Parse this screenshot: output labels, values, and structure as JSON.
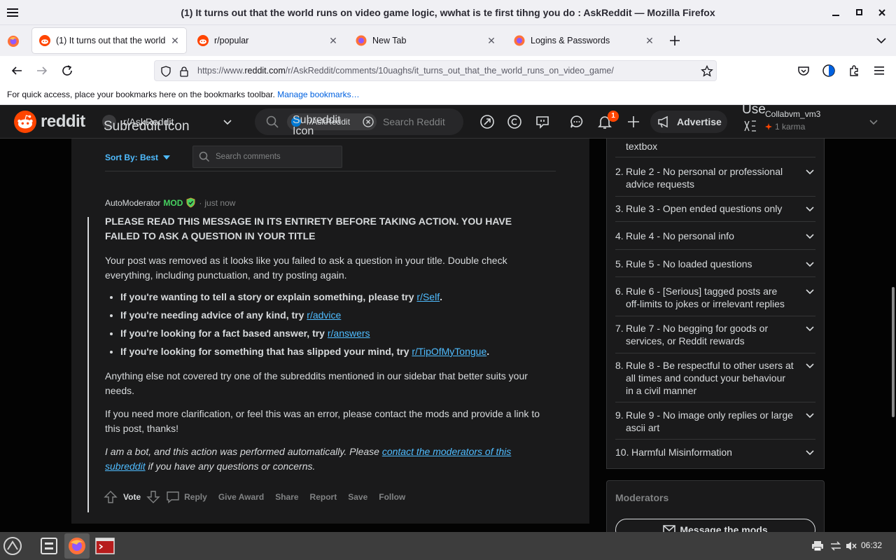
{
  "window": {
    "title": "(1) It turns out that the world runs on video game logic, wwhat is te first tihng you do : AskReddit — Mozilla Firefox"
  },
  "tabs": [
    {
      "label": "(1) It turns out that the world runs on video game logic"
    },
    {
      "label": "r/popular"
    },
    {
      "label": "New Tab"
    },
    {
      "label": "Logins & Passwords"
    }
  ],
  "urlbar": {
    "prefix": "https://www.",
    "domain": "reddit.com",
    "path": "/r/AskReddit/comments/10uaghs/it_turns_out_that_the_world_runs_on_video_game/"
  },
  "bookmarks": {
    "message": "For quick access, place your bookmarks here on the bookmarks toolbar.",
    "link": "Manage bookmarks…"
  },
  "reddit_header": {
    "logo_text": "reddit",
    "subreddit": "r/AskReddit",
    "subreddit_icon_alt": "Subreddit Icon",
    "search_chip": "r/AskReddit",
    "search_chip_alt": "Subreddit Icon",
    "search_placeholder": "Search Reddit",
    "notification_count": "1",
    "advertise_label": "Advertise",
    "user_alt": "Use",
    "username": "Collabvm_vm3",
    "karma": "1 karma",
    "accent": "#ff4500"
  },
  "comments_toolbar": {
    "sort_label": "Sort By: Best",
    "search_placeholder": "Search comments"
  },
  "comment": {
    "author": "AutoModerator",
    "mod_badge": "MOD",
    "separator": "·",
    "time": "just now",
    "heading": "PLEASE READ THIS MESSAGE IN ITS ENTIRETY BEFORE TAKING ACTION. YOU HAVE FAILED TO ASK A QUESTION IN YOUR TITLE",
    "para1": "Your post was removed as it looks like you failed to ask a question in your title. Double check everything, including punctuation, and try posting again.",
    "bullets": [
      {
        "text": "If you're wanting to tell a story or explain something, please try ",
        "link": "r/Self",
        "after": "."
      },
      {
        "text": "If you're needing advice of any kind, try ",
        "link": "r/advice",
        "after": ""
      },
      {
        "text": "If you're looking for a fact based answer, try ",
        "link": "r/answers",
        "after": ""
      },
      {
        "text": "If you're looking for something that has slipped your mind, try ",
        "link": "r/TipOfMyTongue",
        "after": "."
      }
    ],
    "para2": "Anything else not covered try one of the subreddits mentioned in our sidebar that better suits your needs.",
    "para3": "If you need more clarification, or feel this was an error, please contact the mods and provide a link to this post, thanks!",
    "bot_before": "I am a bot, and this action was performed automatically. Please ",
    "bot_link": "contact the moderators of this subreddit",
    "bot_after": " if you have any questions or concerns.",
    "actions": {
      "vote": "Vote",
      "reply": "Reply",
      "give_award": "Give Award",
      "share": "Share",
      "report": "Report",
      "save": "Save",
      "follow": "Follow"
    }
  },
  "rules": {
    "partial_top": "textbox",
    "items": [
      {
        "num": "2.",
        "text": "Rule 2 - No personal or professional advice requests"
      },
      {
        "num": "3.",
        "text": "Rule 3 - Open ended questions only"
      },
      {
        "num": "4.",
        "text": "Rule 4 - No personal info"
      },
      {
        "num": "5.",
        "text": "Rule 5 - No loaded questions"
      },
      {
        "num": "6.",
        "text": "Rule 6 - [Serious] tagged posts are off-limits to jokes or irrelevant replies"
      },
      {
        "num": "7.",
        "text": "Rule 7 - No begging for goods or services, or Reddit rewards"
      },
      {
        "num": "8.",
        "text": "Rule 8 - Be respectful to other users at all times and conduct your behaviour in a civil manner"
      },
      {
        "num": "9.",
        "text": "Rule 9 - No image only replies or large ascii art"
      },
      {
        "num": "10.",
        "text": "Harmful Misinformation"
      }
    ]
  },
  "moderators": {
    "title": "Moderators",
    "button": "Message the mods"
  },
  "taskbar": {
    "clock": "06:32"
  }
}
